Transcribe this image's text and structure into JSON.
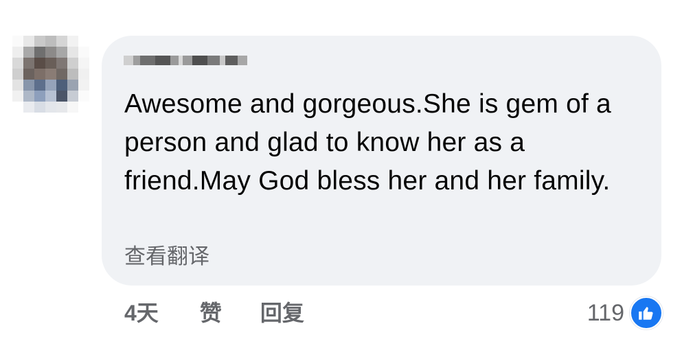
{
  "comment": {
    "author_avatar": "blurred-avatar",
    "author_name": "blurred-name",
    "text": "Awesome and gorgeous.She is gem of a person and glad to know her as a friend.May God bless her and her family.",
    "translate_label": "查看翻译"
  },
  "actions": {
    "time": "4天",
    "like_label": "赞",
    "reply_label": "回复"
  },
  "reactions": {
    "count": "119",
    "icon": "thumbs-up-icon",
    "icon_color": "#1877f2"
  },
  "colors": {
    "bubble": "#f0f2f5",
    "text": "#050505",
    "secondary": "#65676b",
    "accent": "#1877f2"
  }
}
